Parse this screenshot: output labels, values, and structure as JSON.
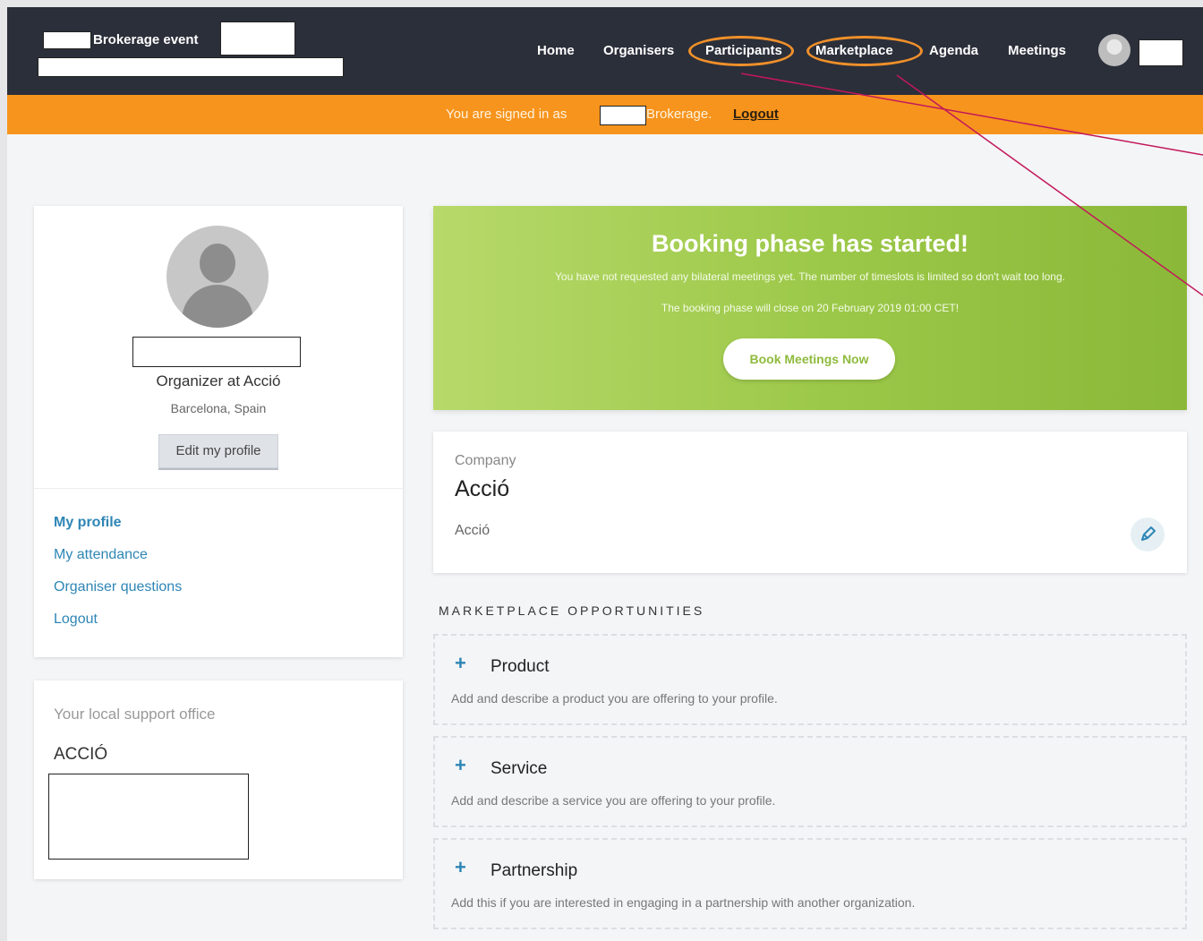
{
  "header": {
    "brand_label": "Brokerage event",
    "nav": [
      {
        "label": "Home"
      },
      {
        "label": "Organisers"
      },
      {
        "label": "Participants"
      },
      {
        "label": "Marketplace"
      },
      {
        "label": "Agenda"
      },
      {
        "label": "Meetings"
      }
    ],
    "highlight_color": "#f0902a"
  },
  "notice": {
    "prefix": "You are signed in as",
    "suffix": "Brokerage.",
    "logout": "Logout",
    "color": "#f7941d"
  },
  "profile": {
    "role": "Organizer at Acció",
    "location": "Barcelona, Spain",
    "edit_button": "Edit my profile",
    "links": [
      "My profile",
      "My attendance",
      "Organiser questions",
      "Logout"
    ]
  },
  "support": {
    "title": "Your local support office",
    "office": "ACCIÓ"
  },
  "banner": {
    "title": "Booking phase has started!",
    "line1": "You have not requested any bilateral meetings yet. The number of timeslots is limited so don't wait too long.",
    "line2": "The booking phase will close on 20 February 2019 01:00 CET!",
    "button": "Book Meetings Now",
    "color": "#9dc94a"
  },
  "company": {
    "label": "Company",
    "name": "Acció",
    "description": "Acció"
  },
  "marketplace": {
    "title": "MARKETPLACE OPPORTUNITIES",
    "items": [
      {
        "title": "Product",
        "description": "Add and describe a product you are offering to your profile."
      },
      {
        "title": "Service",
        "description": "Add and describe a service you are offering to your profile."
      },
      {
        "title": "Partnership",
        "description": "Add this if you are interested in engaging in a partnership with another organization."
      }
    ]
  }
}
